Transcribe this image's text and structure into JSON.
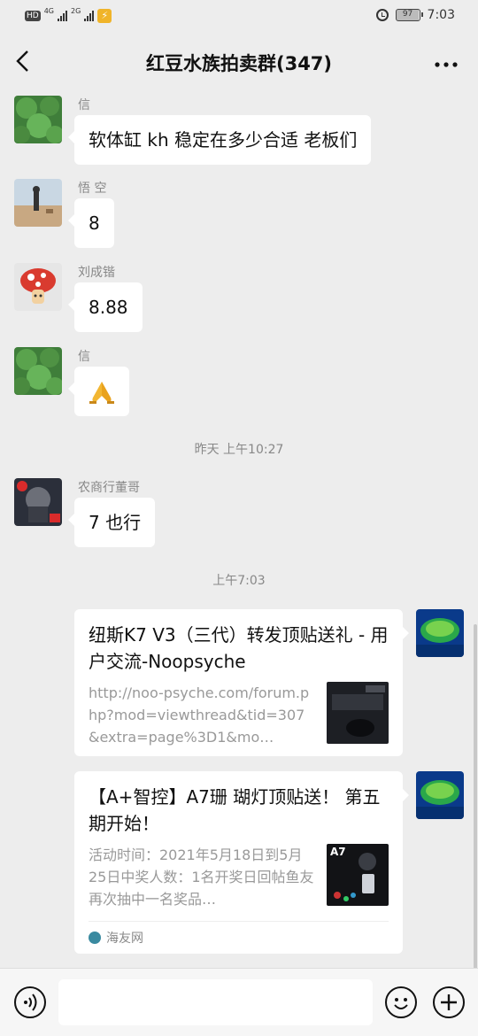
{
  "status_bar": {
    "hd_label": "HD",
    "net1": "4G",
    "net2": "2G",
    "battery": "97",
    "time": "7:03"
  },
  "header": {
    "title": "红豆水族拍卖群(347)",
    "back_icon": "chevron-left-icon",
    "more_icon": "more-icon"
  },
  "messages": [
    {
      "sender": "信",
      "text": "软体缸 kh 稳定在多少合适 老板们"
    },
    {
      "sender": "悟 空",
      "text": "8"
    },
    {
      "sender": "刘成锴",
      "text": "8.88"
    },
    {
      "sender": "信",
      "text": "🙏"
    },
    {
      "sender": "农商行董哥",
      "text": "7 也行"
    }
  ],
  "timestamps": {
    "t1": "昨天 上午10:27",
    "t2": "上午7:03"
  },
  "cards": [
    {
      "title": "纽斯K7 V3（三代）转发顶贴送礼 - 用户交流-Noopsyche",
      "desc": "http://noo-psyche.com/forum.php?mod=viewthread&tid=307&extra=page%3D1&mo…"
    },
    {
      "title": "【A+智控】A7珊 瑚灯顶贴送！ 第五期开始！",
      "desc": "活动时间：2021年5月18日到5月25日中奖人数：1名开奖日回帖鱼友再次抽中一名奖品…",
      "thumb_label": "A7",
      "source": "海友网"
    }
  ],
  "input_bar": {
    "voice_icon": "voice-icon",
    "emoji_icon": "emoji-icon",
    "plus_icon": "plus-icon"
  },
  "colors": {
    "background": "#ededed",
    "bubble": "#ffffff",
    "text_muted": "#888888"
  }
}
